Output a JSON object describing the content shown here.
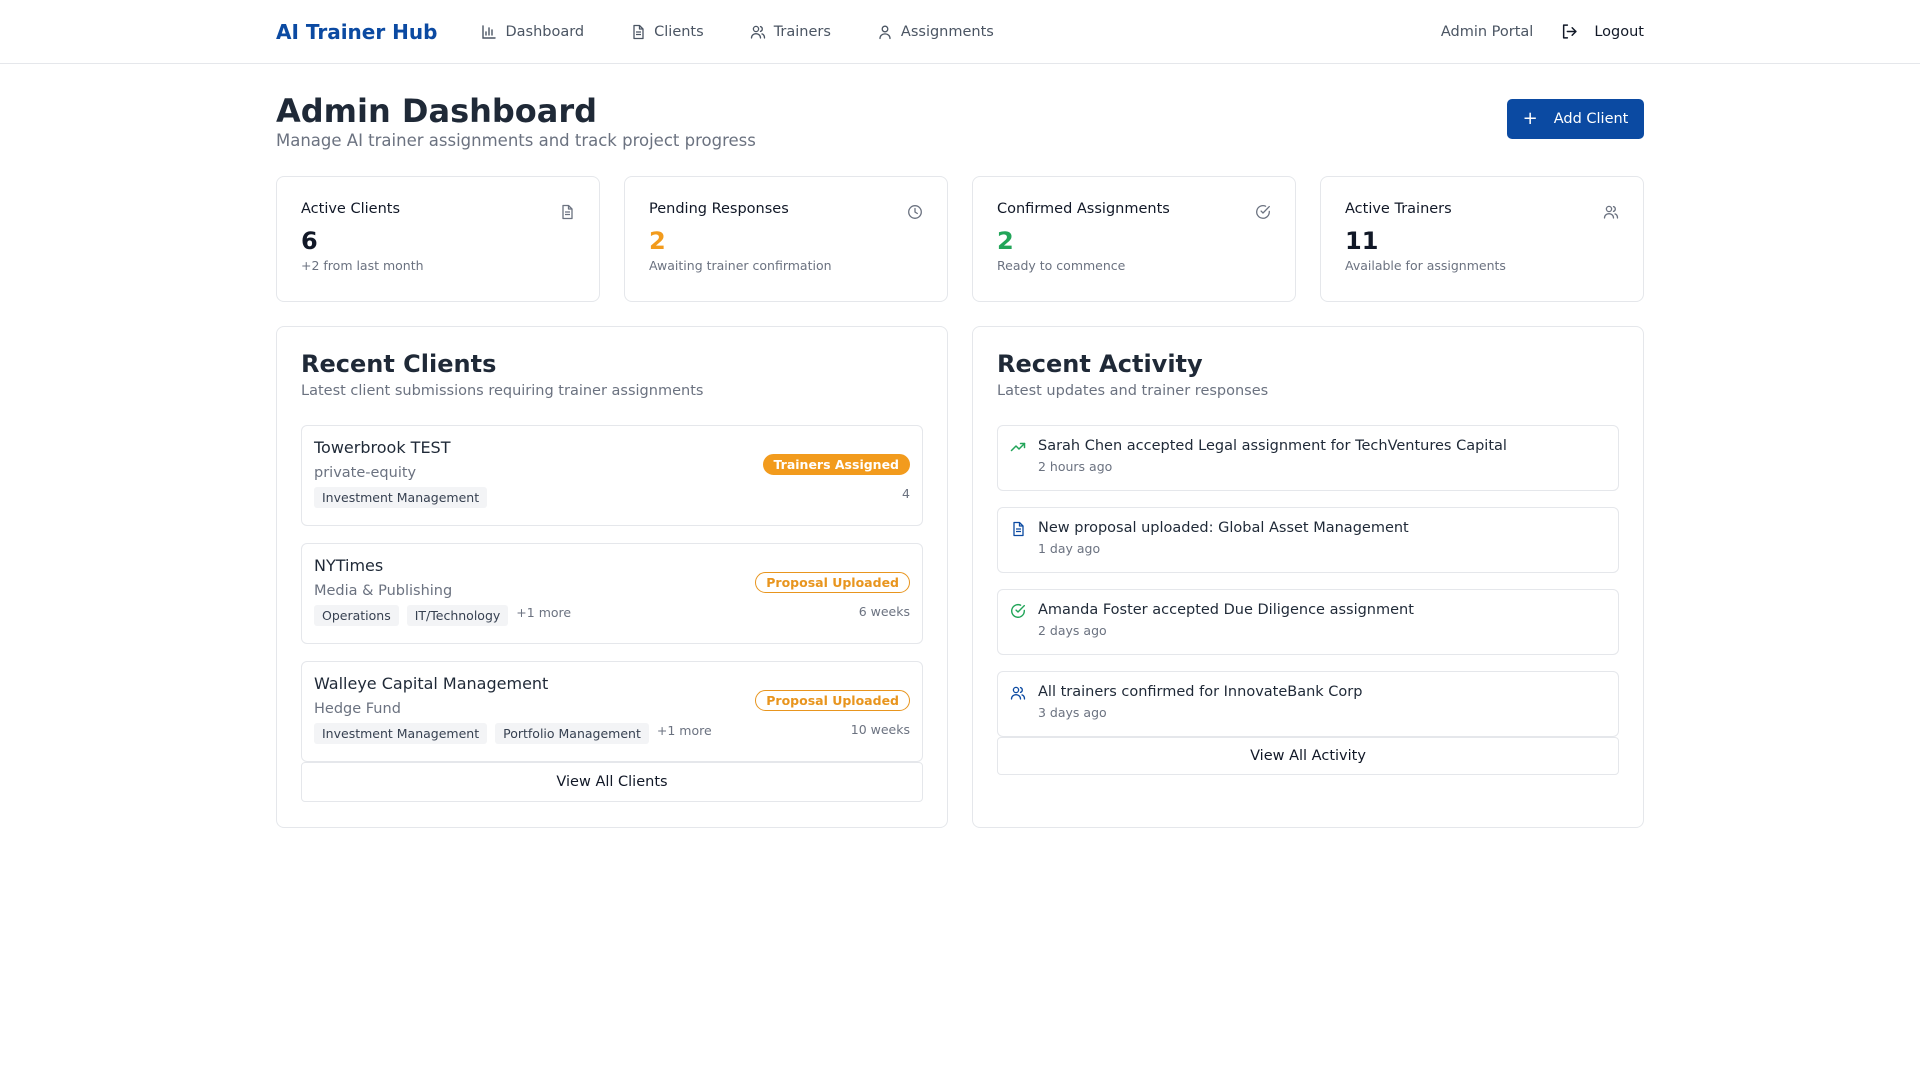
{
  "header": {
    "brand": "AI Trainer Hub",
    "nav": [
      {
        "label": "Dashboard",
        "icon": "bar-chart-icon"
      },
      {
        "label": "Clients",
        "icon": "document-icon"
      },
      {
        "label": "Trainers",
        "icon": "users-icon"
      },
      {
        "label": "Assignments",
        "icon": "user-icon"
      }
    ],
    "portal_label": "Admin Portal",
    "logout_label": "Logout"
  },
  "page": {
    "title": "Admin Dashboard",
    "subtitle": "Manage AI trainer assignments and track project progress",
    "add_client_label": "Add Client"
  },
  "stats": [
    {
      "label": "Active Clients",
      "value": "6",
      "note": "+2 from last month",
      "icon": "document-icon",
      "color": "#111827"
    },
    {
      "label": "Pending Responses",
      "value": "2",
      "note": "Awaiting trainer confirmation",
      "icon": "clock-icon",
      "color": "#f29b1d"
    },
    {
      "label": "Confirmed Assignments",
      "value": "2",
      "note": "Ready to commence",
      "icon": "check-circle-icon",
      "color": "#22a559"
    },
    {
      "label": "Active Trainers",
      "value": "11",
      "note": "Available for assignments",
      "icon": "users-icon",
      "color": "#111827"
    }
  ],
  "recent_clients": {
    "title": "Recent Clients",
    "subtitle": "Latest client submissions requiring trainer assignments",
    "items": [
      {
        "name": "Towerbrook TEST",
        "industry": "private-equity",
        "tags": [
          "Investment Management"
        ],
        "more": "",
        "status": "Trainers Assigned",
        "meta": "4"
      },
      {
        "name": "NYTimes",
        "industry": "Media & Publishing",
        "tags": [
          "Operations",
          "IT/Technology"
        ],
        "more": "+1 more",
        "status": "Proposal Uploaded",
        "meta": "6 weeks"
      },
      {
        "name": "Walleye Capital Management",
        "industry": "Hedge Fund",
        "tags": [
          "Investment Management",
          "Portfolio Management"
        ],
        "more": "+1 more",
        "status": "Proposal Uploaded",
        "meta": "10 weeks"
      }
    ],
    "view_all_label": "View All Clients"
  },
  "recent_activity": {
    "title": "Recent Activity",
    "subtitle": "Latest updates and trainer responses",
    "items": [
      {
        "text": "Sarah Chen accepted Legal assignment for TechVentures Capital",
        "time": "2 hours ago",
        "icon": "trending-up-icon",
        "color": "#22a559"
      },
      {
        "text": "New proposal uploaded: Global Asset Management",
        "time": "1 day ago",
        "icon": "document-icon",
        "color": "#0b4aa2"
      },
      {
        "text": "Amanda Foster accepted Due Diligence assignment",
        "time": "2 days ago",
        "icon": "check-circle-icon",
        "color": "#22a559"
      },
      {
        "text": "All trainers confirmed for InnovateBank Corp",
        "time": "3 days ago",
        "icon": "users-icon",
        "color": "#0b4aa2"
      }
    ],
    "view_all_label": "View All Activity"
  }
}
